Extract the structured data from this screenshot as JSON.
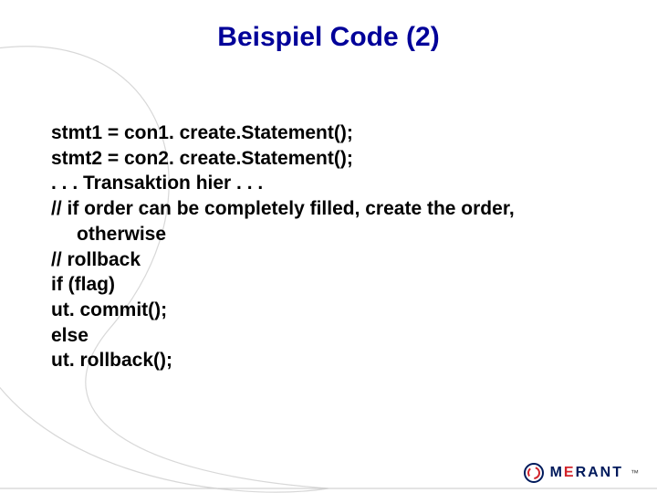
{
  "slide": {
    "title": "Beispiel Code (2)"
  },
  "code": {
    "l1": "stmt1 = con1. create.Statement();",
    "l2": "stmt2 = con2. create.Statement();",
    "l3": ". . . Transaktion hier . . .",
    "l4": "// if order can be completely filled, create the order,",
    "l4b": "otherwise",
    "l5": "// rollback",
    "l6": "if (flag)",
    "l7": "ut. commit();",
    "l8": "else",
    "l9": "ut. rollback();"
  },
  "brand": {
    "name_pre": "M",
    "name_accent": "E",
    "name_post": "RANT",
    "tm": "™"
  },
  "colors": {
    "title": "#000099",
    "accent_red": "#d2232a",
    "brand_navy": "#001a5c"
  }
}
